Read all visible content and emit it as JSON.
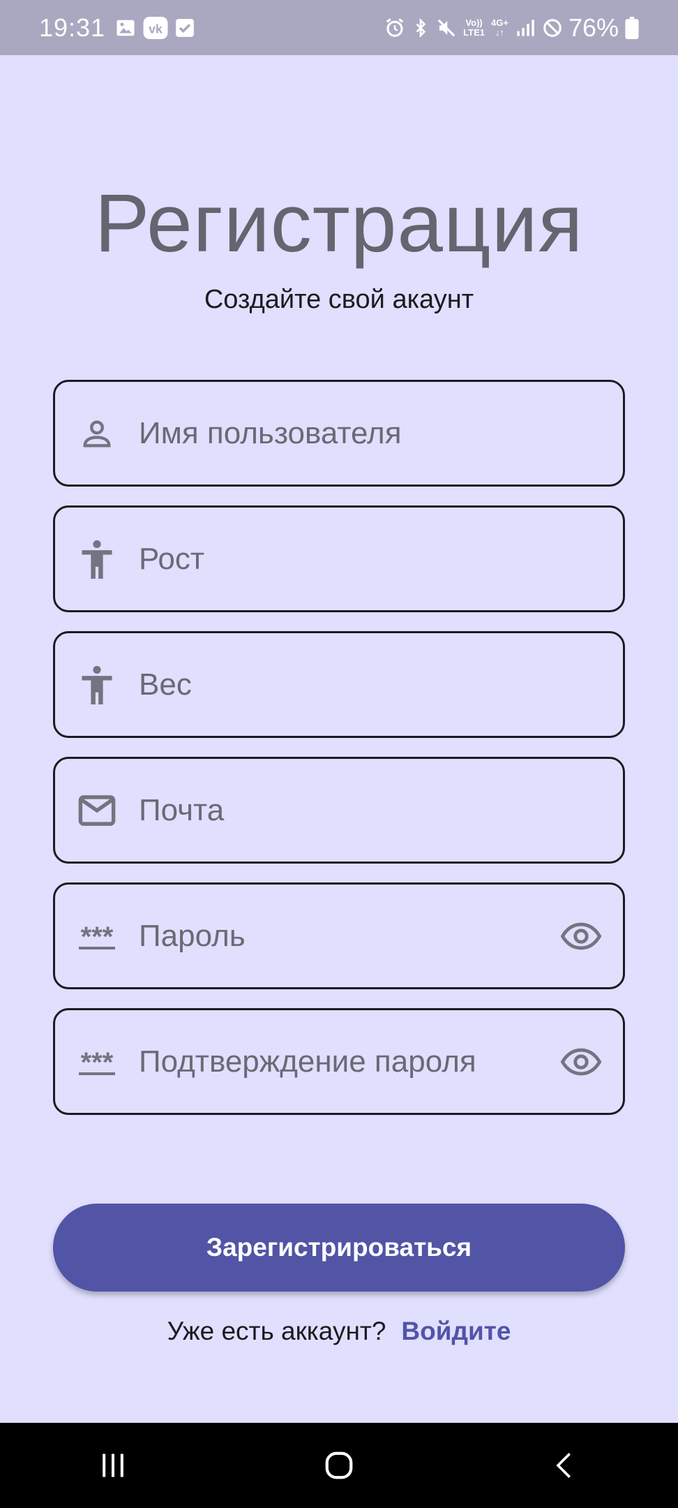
{
  "status_bar": {
    "time": "19:31",
    "left_icons": [
      "image-icon",
      "vk-icon",
      "check-icon"
    ],
    "right_icons": [
      "alarm-icon",
      "bluetooth-icon",
      "mute-icon",
      "volte-icon",
      "data-4g-icon",
      "signal-icon",
      "dnd-icon",
      "battery-icon"
    ],
    "volte_top": "Vo))",
    "volte_bottom": "LTE1",
    "net_label": "4G+",
    "battery": "76%"
  },
  "header": {
    "title": "Регистрация",
    "subtitle": "Создайте свой акаунт"
  },
  "form": {
    "username": {
      "placeholder": "Имя пользователя",
      "icon": "person-icon"
    },
    "height": {
      "placeholder": "Рост",
      "icon": "accessibility-icon"
    },
    "weight": {
      "placeholder": "Вес",
      "icon": "accessibility-icon"
    },
    "email": {
      "placeholder": "Почта",
      "icon": "mail-icon"
    },
    "password": {
      "placeholder": "Пароль",
      "icon": "password-icon",
      "trailing_icon": "eye-icon",
      "mask": "***"
    },
    "password_confirm": {
      "placeholder": "Подтверждение пароля",
      "icon": "password-icon",
      "trailing_icon": "eye-icon",
      "mask": "***"
    }
  },
  "actions": {
    "register_label": "Зарегистрироваться",
    "login_prompt": "Уже есть аккаунт?",
    "login_link": "Войдите"
  },
  "nav_bar": {
    "buttons": [
      "recents-icon",
      "home-icon",
      "back-icon"
    ]
  },
  "colors": {
    "background": "#e0dffe",
    "status_bar": "#a9a8c0",
    "primary": "#5254a6",
    "title": "#65646f",
    "icon": "#747380"
  }
}
